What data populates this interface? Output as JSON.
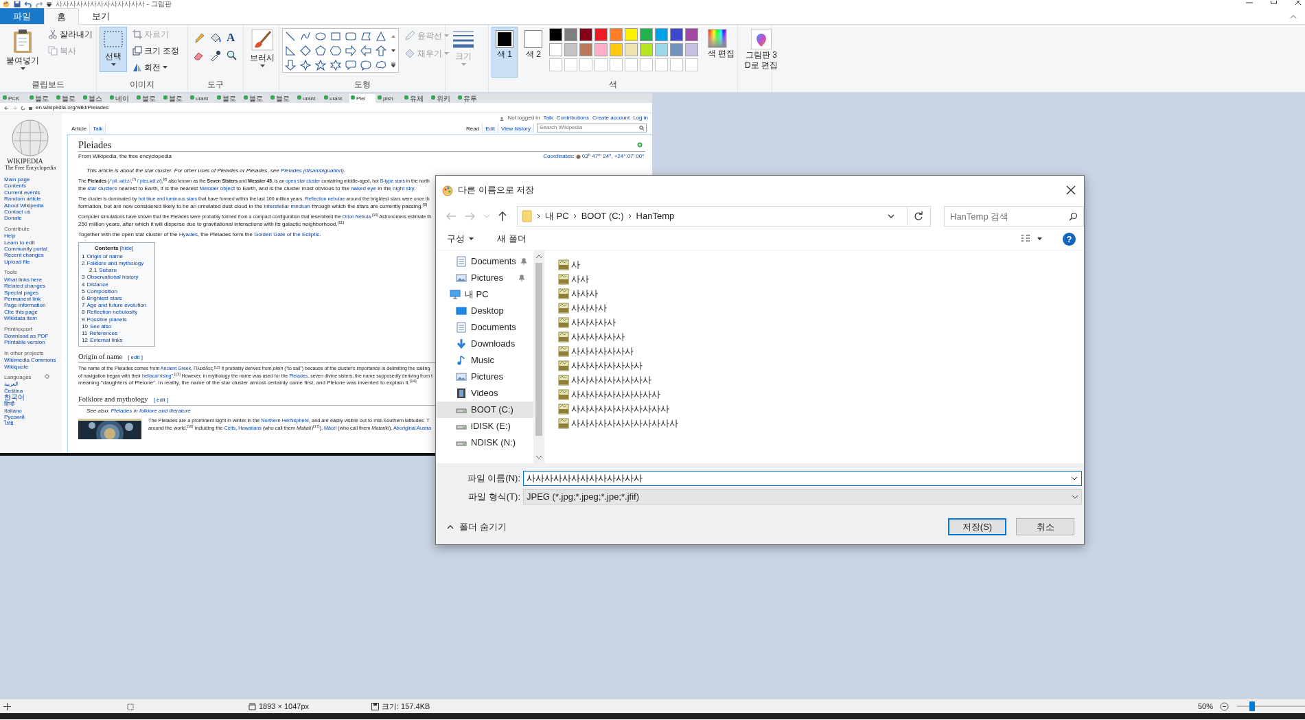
{
  "window": {
    "title": "사사사사사사사사사사사사사 - 그림판"
  },
  "menu_tabs": [
    {
      "label": "파일",
      "kind": "file",
      "selected": false
    },
    {
      "label": "홈",
      "kind": "tab",
      "selected": true
    },
    {
      "label": "보기",
      "kind": "tab",
      "selected": false
    }
  ],
  "ribbon": {
    "clipboard": {
      "label": "클립보드",
      "paste": "붙여넣기",
      "cut": {
        "label": "잘라내기",
        "disabled": false
      },
      "copy": {
        "label": "복사",
        "disabled": true
      }
    },
    "image": {
      "label": "이미지",
      "select": {
        "label": "선택",
        "selected": true
      },
      "crop": {
        "label": "자르기",
        "disabled": true
      },
      "resize": "크기 조정",
      "rotate": "회전"
    },
    "tools": {
      "label": "도구",
      "text_tool": "A"
    },
    "brushes": "브러시",
    "shapes": {
      "label": "도형",
      "outline": {
        "label": "윤곽선",
        "disabled": true
      },
      "fill": {
        "label": "채우기",
        "disabled": true
      }
    },
    "size": {
      "label": "크기",
      "disabled": true
    },
    "colors": {
      "label": "색",
      "current": [
        {
          "label": "색 1",
          "color": "#000000",
          "selected": true
        },
        {
          "label": "색 2",
          "color": "#ffffff",
          "selected": false
        }
      ],
      "palette": [
        {
          "color": "#000000"
        },
        {
          "color": "#7f7f7f"
        },
        {
          "color": "#880015"
        },
        {
          "color": "#ed1c24"
        },
        {
          "color": "#ff7f27"
        },
        {
          "color": "#fff200"
        },
        {
          "color": "#22b14c"
        },
        {
          "color": "#00a2e8"
        },
        {
          "color": "#3f48cc"
        },
        {
          "color": "#a349a4"
        },
        {
          "color": "#ffffff"
        },
        {
          "color": "#c3c3c3"
        },
        {
          "color": "#b97a57"
        },
        {
          "color": "#ffaec9"
        },
        {
          "color": "#ffc90e"
        },
        {
          "color": "#efe4b0"
        },
        {
          "color": "#b5e61d"
        },
        {
          "color": "#99d9ea"
        },
        {
          "color": "#7092be"
        },
        {
          "color": "#c8bfe7"
        }
      ],
      "edit": "색 편집"
    },
    "paint3d": "그림판 3D로 편집"
  },
  "canvas": {
    "browser_tabs": [
      {
        "label": "PCK",
        "selected": false
      },
      {
        "label": "블로",
        "selected": false
      },
      {
        "label": "블로",
        "selected": false
      },
      {
        "label": "블스",
        "selected": false
      },
      {
        "label": "네이",
        "selected": false
      },
      {
        "label": "블로",
        "selected": false
      },
      {
        "label": "블로",
        "selected": false
      },
      {
        "label": "urant",
        "selected": false
      },
      {
        "label": "블로",
        "selected": false
      },
      {
        "label": "블로",
        "selected": false
      },
      {
        "label": "블로",
        "selected": false
      },
      {
        "label": "urant",
        "selected": false
      },
      {
        "label": "urant",
        "selected": false
      },
      {
        "label": "Plei",
        "selected": true
      },
      {
        "label": "pish",
        "selected": false
      },
      {
        "label": "유체",
        "selected": false
      },
      {
        "label": "위키",
        "selected": false
      },
      {
        "label": "유투",
        "selected": false
      }
    ],
    "address": "en.wikipedia.org/wiki/Pleiades",
    "logo_title": "WIKIPEDIA",
    "logo_tagline": "The Free Encyclopedia",
    "sidebar": [
      {
        "items": [
          "Main page",
          "Contents",
          "Current events",
          "Random article",
          "About Wikipedia",
          "Contact us",
          "Donate"
        ]
      },
      {
        "heading": "Contribute",
        "items": [
          "Help",
          "Learn to edit",
          "Community portal",
          "Recent changes",
          "Upload file"
        ]
      },
      {
        "heading": "Tools",
        "items": [
          "What links here",
          "Related changes",
          "Special pages",
          "Permanent link",
          "Page information",
          "Cite this page",
          "Wikidata item"
        ]
      },
      {
        "heading": "Print/export",
        "items": [
          "Download as PDF",
          "Printable version"
        ]
      },
      {
        "heading": "In other projects",
        "items": [
          "Wikimedia Commons",
          "Wikiquote"
        ]
      },
      {
        "heading": "Languages",
        "settings": true,
        "items": [
          "العربية",
          "Čeština",
          "한국어",
          "हिन्दी",
          "Italiano",
          "Русский",
          "ไทย"
        ]
      }
    ],
    "personal": [
      "Not logged in",
      "Talk",
      "Contributions",
      "Create account",
      "Log in"
    ],
    "left_tabs": [
      {
        "label": "Article",
        "selected": true
      },
      {
        "label": "Talk",
        "selected": false
      }
    ],
    "right_tabs": [
      {
        "label": "Read",
        "selected": true
      },
      {
        "label": "Edit",
        "selected": false
      },
      {
        "label": "View history",
        "selected": false
      }
    ],
    "search_placeholder": "Search Wikipedia",
    "title": "Pleiades",
    "tagline": "From Wikipedia, the free encyclopedia",
    "coordinates_label": "Coordinates:",
    "coordinates": "03$^{h}$ 47$^{m}$ 24$^{s}$, +24° 07′ 00″",
    "hatnote": [
      "This article is about the star cluster. For other uses of Pleiades or Pléiades, see ",
      {
        "link": "Pleiades (disambiguation)"
      },
      "."
    ],
    "intro": [
      [
        [
          "The **Pleiades** (",
          {
            "link": "/ˈpliː.ədiːz/"
          },
          ",$^{[7]}$ ",
          {
            "link": "/ˈpleɪ.ədiːz/"
          },
          "),$^{[8]}$ also known as the **Seven Sisters** and **Messier 45**, is an ",
          {
            "link": "open star cluster"
          },
          " containing middle-aged, hot ",
          {
            "link": "B-type stars"
          },
          " in the north"
        ],
        [
          "the ",
          {
            "link": "star clusters"
          },
          " nearest to Earth, it is the nearest ",
          {
            "link": "Messier object"
          },
          " to Earth, and is the cluster most obvious to the ",
          {
            "link": "naked eye"
          },
          " in the ",
          {
            "link": "night sky"
          },
          "."
        ]
      ],
      [
        [
          "The cluster is dominated by ",
          {
            "link": "hot blue and luminous stars"
          },
          " that have formed within the last 100 million years. ",
          {
            "link": "Reflection nebulae"
          },
          " around the brightest stars were once th"
        ],
        [
          "formation, but are now considered likely to be an unrelated dust cloud in the ",
          {
            "link": "interstellar medium"
          },
          " through which the stars are currently passing.$^{[9]}$"
        ]
      ],
      [
        [
          "Computer simulations have shown that the Pleiades were probably formed from a compact configuration that resembled the ",
          {
            "link": "Orion Nebula"
          },
          ".$^{[10]}$ Astronomers estimate th"
        ],
        [
          "250 million years, after which it will disperse due to gravitational interactions with its galactic neighborhood.$^{[11]}$"
        ]
      ],
      [
        [
          "Together with the open star cluster of the ",
          {
            "link": "Hyades"
          },
          ", the Pleiades form the ",
          {
            "link": "Golden Gate of the Ecliptic"
          },
          "."
        ]
      ]
    ],
    "contents": {
      "title": "Contents",
      "hide": "[hide]",
      "items": [
        {
          "number": "1",
          "label": "Origin of name"
        },
        {
          "number": "2",
          "label": "Folklore and mythology",
          "children": [
            {
              "number": "2.1",
              "label": "Subaru"
            }
          ]
        },
        {
          "number": "3",
          "label": "Observational history"
        },
        {
          "number": "4",
          "label": "Distance"
        },
        {
          "number": "5",
          "label": "Composition"
        },
        {
          "number": "6",
          "label": "Brightest stars"
        },
        {
          "number": "7",
          "label": "Age and future evolution"
        },
        {
          "number": "8",
          "label": "Reflection nebulosity"
        },
        {
          "number": "9",
          "label": "Possible planets"
        },
        {
          "number": "10",
          "label": "See also"
        },
        {
          "number": "11",
          "label": "References"
        },
        {
          "number": "12",
          "label": "External links"
        }
      ]
    },
    "sections": [
      {
        "heading": "Origin of name",
        "edit": "[ edit ]",
        "lines": [
          [
            "The name of the Pleiades comes from ",
            {
              "link": "Ancient Greek"
            },
            ", Πλειάδες.$^{[12]}$ It probably derives from *plein* (\"to sail\") because of the cluster's importance in delimiting the sailing"
          ],
          [
            "of navigation began with their ",
            {
              "link": "heliacal rising"
            },
            "\".$^{[13]}$ However, in mythology the name was used for the ",
            {
              "link": "Pleiades"
            },
            ", seven divine sisters, the name supposedly deriving from t"
          ],
          [
            "meaning \"daughters of Pleione\". In reality, the name of the star cluster almost certainly came first, and Pleione was invented to explain it.$^{[14]}$"
          ]
        ]
      },
      {
        "heading": "Folklore and mythology",
        "edit": "[ edit ]",
        "see_also": [
          "See also: ",
          {
            "link": "Pleiades in folklore and literature"
          }
        ],
        "picture": {
          "kind": "picture"
        },
        "lines": [
          [
            "The Pleiades are a prominent sight in winter in the ",
            {
              "link": "Northern Hemisphere"
            },
            ", and are easily visible out to mid-Southern latitudes. T"
          ],
          [
            "around the world,$^{[16]}$ including the ",
            {
              "link": "Celts"
            },
            ", ",
            {
              "link": "Hawaiians"
            },
            " (who call them *Makaliʻi*$^{[17]}$), ",
            {
              "link": "Māori"
            },
            " (who call them *Matariki*), ",
            {
              "link": "Aboriginal Austra"
            }
          ]
        ]
      }
    ]
  },
  "dialog": {
    "title": "다른 이름으로 저장",
    "path": [
      "내 PC",
      "BOOT (C:)",
      "HanTemp"
    ],
    "search_placeholder": "HanTemp 검색",
    "organize": "구성",
    "new_folder": "새 폴더",
    "help": "?",
    "nav": [
      {
        "label": "Documents",
        "kind": "documents",
        "pinned": true,
        "selected": false
      },
      {
        "label": "Pictures",
        "kind": "pictures",
        "pinned": true,
        "selected": false
      },
      {
        "label": "내 PC",
        "kind": "pc",
        "pinned": false,
        "selected": false,
        "children": [
          {
            "label": "Desktop",
            "kind": "desktop",
            "pinned": false,
            "selected": false
          },
          {
            "label": "Documents",
            "kind": "documents",
            "pinned": false,
            "selected": false
          },
          {
            "label": "Downloads",
            "kind": "downloads",
            "pinned": false,
            "selected": false
          },
          {
            "label": "Music",
            "kind": "music",
            "pinned": false,
            "selected": false
          },
          {
            "label": "Pictures",
            "kind": "pictures",
            "pinned": false,
            "selected": false
          },
          {
            "label": "Videos",
            "kind": "videos",
            "pinned": false,
            "selected": false
          },
          {
            "label": "BOOT (C:)",
            "kind": "drive",
            "pinned": false,
            "selected": true
          },
          {
            "label": "iDISK (E:)",
            "kind": "drive",
            "pinned": false,
            "selected": false
          },
          {
            "label": "NDISK (N:)",
            "kind": "drive",
            "pinned": false,
            "selected": false
          }
        ]
      }
    ],
    "files": [
      "사",
      "사사",
      "사사사",
      "사사사사",
      "사사사사사",
      "사사사사사사",
      "사사사사사사사",
      "사사사사사사사사",
      "사사사사사사사사사",
      "사사사사사사사사사사",
      "사사사사사사사사사사사",
      "사사사사사사사사사사사사"
    ],
    "filename_label": "파일 이름(N):",
    "filename": "사사사사사사사사사사사사사",
    "filetype_label": "파일 형식(T):",
    "filetype": "JPEG (*.jpg;*.jpeg;*.jpe;*.jfif)",
    "hide_folders": "폴더 숨기기",
    "save": "저장(S)",
    "cancel": "취소"
  },
  "status_bar": {
    "dimensions": "1893 × 1047px",
    "file_size": "크기: 157.4KB",
    "zoom": "50%",
    "zoom_slider": {
      "level": 0.2
    }
  }
}
